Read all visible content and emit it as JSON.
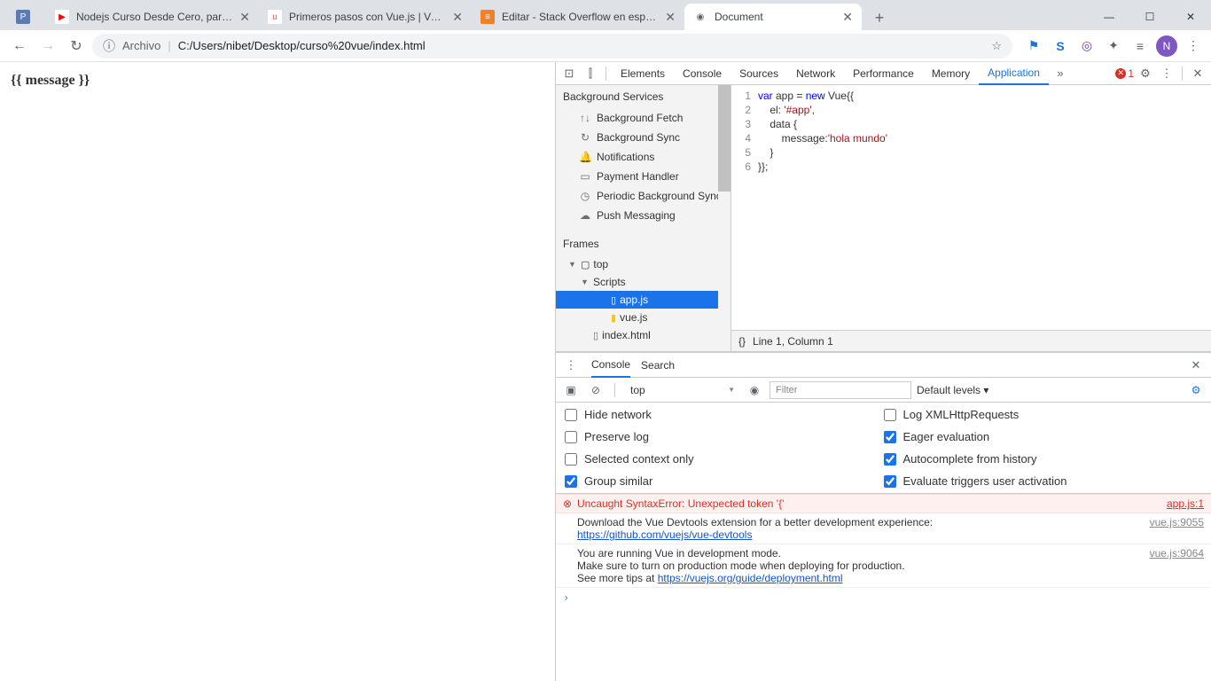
{
  "browser": {
    "tabs": [
      {
        "title": "",
        "favicon_bg": "#5b7bb4",
        "favicon_text": "P",
        "favicon_color": "#fff"
      },
      {
        "title": "Nodejs Curso Desde Cero, para p",
        "favicon_bg": "#fff",
        "favicon_text": "▶",
        "favicon_color": "#f00"
      },
      {
        "title": "Primeros pasos con Vue.js | Vue e",
        "favicon_bg": "#fff",
        "favicon_text": "u",
        "favicon_color": "#ec5252"
      },
      {
        "title": "Editar - Stack Overflow en españo",
        "favicon_bg": "#f48024",
        "favicon_text": "≡",
        "favicon_color": "#fff"
      },
      {
        "title": "Document",
        "favicon_bg": "#fff",
        "favicon_text": "◉",
        "favicon_color": "#5f6368",
        "active": true
      }
    ],
    "newtab": "+",
    "window": {
      "min": "—",
      "max": "☐",
      "close": "✕"
    },
    "nav": {
      "back": "←",
      "forward": "→",
      "reload": "↻"
    },
    "omnibox": {
      "info": "ⓘ",
      "scheme": "Archivo",
      "sep": "|",
      "url": "C:/Users/nibet/Desktop/curso%20vue/index.html",
      "star": "☆"
    },
    "ext": {
      "e1": "⚑",
      "e2": "S",
      "e3": "◎",
      "e4": "✦",
      "e5": "≡"
    },
    "avatar": "N",
    "menu": "⋮"
  },
  "page": {
    "body": "{{ message }}"
  },
  "devtools": {
    "top_icons": {
      "inspect": "⊡",
      "device": "⫿"
    },
    "tabs": [
      "Elements",
      "Console",
      "Sources",
      "Network",
      "Performance",
      "Memory",
      "Application"
    ],
    "active_tab": "Application",
    "more": "»",
    "error_count": "1",
    "gear": "⚙",
    "kebab": "⋮",
    "close": "✕"
  },
  "app_panel": {
    "bg_services": {
      "header": "Background Services",
      "items": [
        {
          "icon": "↑↓",
          "label": "Background Fetch"
        },
        {
          "icon": "↻",
          "label": "Background Sync"
        },
        {
          "icon": "🔔",
          "label": "Notifications"
        },
        {
          "icon": "▭",
          "label": "Payment Handler"
        },
        {
          "icon": "◷",
          "label": "Periodic Background Sync"
        },
        {
          "icon": "☁",
          "label": "Push Messaging"
        }
      ]
    },
    "frames": {
      "header": "Frames",
      "top": "top",
      "scripts": "Scripts",
      "files": [
        {
          "name": "app.js",
          "selected": true,
          "icon": "▯",
          "color": "#fff"
        },
        {
          "name": "vue.js",
          "icon": "▮",
          "color": "#f5c518"
        },
        {
          "name": "index.html",
          "icon": "▯",
          "color": "#6e6e6e",
          "depth": 1
        }
      ]
    }
  },
  "source": {
    "lines": [
      {
        "n": "1",
        "html": "<span class='kw'>var</span> app = <span class='kw'>new</span> Vue{{"
      },
      {
        "n": "2",
        "html": "    el: <span class='str'>'#app'</span>,"
      },
      {
        "n": "3",
        "html": "    data {"
      },
      {
        "n": "4",
        "html": "        message:<span class='str'>'hola mundo'</span>"
      },
      {
        "n": "5",
        "html": "    }"
      },
      {
        "n": "6",
        "html": "}};"
      }
    ],
    "status_icon": "{}",
    "status": "Line 1, Column 1"
  },
  "drawer": {
    "kebab": "⋮",
    "tabs": {
      "console": "Console",
      "search": "Search"
    },
    "close": "✕",
    "toolbar": {
      "play": "▣",
      "clear": "⊘",
      "context": "top",
      "eye": "◉",
      "filter_placeholder": "Filter",
      "levels": "Default levels ▾",
      "gear": "⚙"
    },
    "options": [
      {
        "label": "Hide network",
        "checked": false
      },
      {
        "label": "Log XMLHttpRequests",
        "checked": false
      },
      {
        "label": "Preserve log",
        "checked": false
      },
      {
        "label": "Eager evaluation",
        "checked": true
      },
      {
        "label": "Selected context only",
        "checked": false
      },
      {
        "label": "Autocomplete from history",
        "checked": true
      },
      {
        "label": "Group similar",
        "checked": true
      },
      {
        "label": "Evaluate triggers user activation",
        "checked": true
      }
    ],
    "logs": [
      {
        "type": "error",
        "icon": "⊗",
        "msg": "Uncaught SyntaxError: Unexpected token '{'",
        "src": "app.js:1"
      },
      {
        "type": "log",
        "icon": "",
        "msg": "Download the Vue Devtools extension for a better development experience:\n",
        "link": "https://github.com/vuejs/vue-devtools",
        "src": "vue.js:9055"
      },
      {
        "type": "log",
        "icon": "",
        "msg": "You are running Vue in development mode.\nMake sure to turn on production mode when deploying for production.\nSee more tips at ",
        "link": "https://vuejs.org/guide/deployment.html",
        "src": "vue.js:9064"
      }
    ],
    "prompt": "›"
  }
}
